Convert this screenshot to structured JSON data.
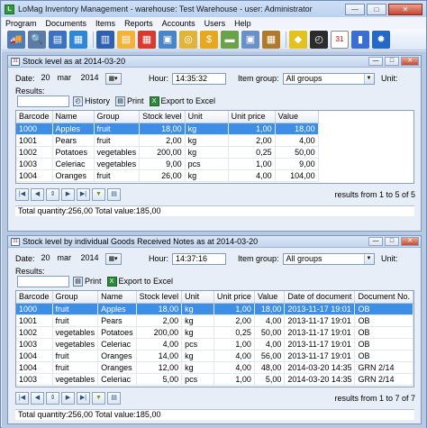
{
  "window": {
    "title": "LoMag Inventory Management - warehouse: Test Warehouse - user: Administrator",
    "app_icon": "L",
    "min": "—",
    "max": "□",
    "close": "✕"
  },
  "menu": [
    "Program",
    "Documents",
    "Items",
    "Reports",
    "Accounts",
    "Users",
    "Help"
  ],
  "toolbar": {
    "icons": [
      "truck-icon",
      "search-doc-icon",
      "stack-icon",
      "blue-doc-icon",
      "book-icon",
      "orange-doc-icon",
      "red-doc-icon",
      "box-icon",
      "coins-icon",
      "dollar-icon",
      "cash-icon",
      "box-out-icon",
      "package-icon",
      "tag-icon",
      "history-icon",
      "calendar-icon",
      "chart-icon",
      "gear-icon"
    ],
    "colors": [
      "#4f7cb5",
      "#5a7da7",
      "#3d72c0",
      "#2e86d8",
      "#2f5fb0",
      "#f0b43c",
      "#d83a2e",
      "#4a85c8",
      "#e0b33a",
      "#e7a820",
      "#6aa24a",
      "#6a90c8",
      "#b07a2c",
      "#e2c21e",
      "#2c2c2c",
      "#ffffff",
      "#3a6ed0",
      "#2568c7"
    ],
    "glyphs": [
      "🚚",
      "🔍",
      "▤",
      "▦",
      "▥",
      "▤",
      "▦",
      "▣",
      "◎",
      "$",
      "▬",
      "▣",
      "▦",
      "◆",
      "◴",
      "31",
      "▮",
      "✹"
    ]
  },
  "win1": {
    "title": "Stock level as at 2014-03-20",
    "cal_icon": "31",
    "date_label": "Date:",
    "date_day": "20",
    "date_month": "mar",
    "date_year": "2014",
    "hour_label": "Hour:",
    "hour": "14:35:32",
    "group_label": "Item group:",
    "group": "All groups",
    "unit_label": "Unit:",
    "results_label": "Results:",
    "history": "History",
    "print": "Print",
    "export": "Export to Excel",
    "columns": [
      "Barcode",
      "Name",
      "Group",
      "Stock level",
      "Unit",
      "Unit price",
      "Value"
    ],
    "rows": [
      [
        "1000",
        "Apples",
        "fruit",
        "18,00",
        "kg",
        "1,00",
        "18,00"
      ],
      [
        "1001",
        "Pears",
        "fruit",
        "2,00",
        "kg",
        "2,00",
        "4,00"
      ],
      [
        "1002",
        "Potatoes",
        "vegetables",
        "200,00",
        "kg",
        "0,25",
        "50,00"
      ],
      [
        "1003",
        "Celeriac",
        "vegetables",
        "9,00",
        "pcs",
        "1,00",
        "9,00"
      ],
      [
        "1004",
        "Oranges",
        "fruit",
        "26,00",
        "kg",
        "4,00",
        "104,00"
      ]
    ],
    "results_text": "results from 1 to 5 of 5",
    "totals": "Total quantity:256,00    Total value:185,00"
  },
  "win2": {
    "title": "Stock level by individual Goods Received Notes as at 2014-03-20",
    "cal_icon": "31",
    "date_label": "Date:",
    "date_day": "20",
    "date_month": "mar",
    "date_year": "2014",
    "hour_label": "Hour:",
    "hour": "14:37:16",
    "group_label": "Item group:",
    "group": "All groups",
    "unit_label": "Unit:",
    "results_label": "Results:",
    "print": "Print",
    "export": "Export to Excel",
    "columns": [
      "Barcode",
      "Group",
      "Name",
      "Stock level",
      "Unit",
      "Unit price",
      "Value",
      "Date of document",
      "Document No."
    ],
    "rows": [
      [
        "1000",
        "fruit",
        "Apples",
        "18,00",
        "kg",
        "1,00",
        "18,00",
        "2013-11-17 19:01",
        "OB"
      ],
      [
        "1001",
        "fruit",
        "Pears",
        "2,00",
        "kg",
        "2,00",
        "4,00",
        "2013-11-17 19:01",
        "OB"
      ],
      [
        "1002",
        "vegetables",
        "Potatoes",
        "200,00",
        "kg",
        "0,25",
        "50,00",
        "2013-11-17 19:01",
        "OB"
      ],
      [
        "1003",
        "vegetables",
        "Celeriac",
        "4,00",
        "pcs",
        "1,00",
        "4,00",
        "2013-11-17 19:01",
        "OB"
      ],
      [
        "1004",
        "fruit",
        "Oranges",
        "14,00",
        "kg",
        "4,00",
        "56,00",
        "2013-11-17 19:01",
        "OB"
      ],
      [
        "1004",
        "fruit",
        "Oranges",
        "12,00",
        "kg",
        "4,00",
        "48,00",
        "2014-03-20 14:35",
        "GRN 2/14"
      ],
      [
        "1003",
        "vegetables",
        "Celeriac",
        "5,00",
        "pcs",
        "1,00",
        "5,00",
        "2014-03-20 14:35",
        "GRN 2/14"
      ]
    ],
    "results_text": "results from 1 to 7 of 7",
    "totals": "Total quantity:256,00    Total value:185,00"
  }
}
